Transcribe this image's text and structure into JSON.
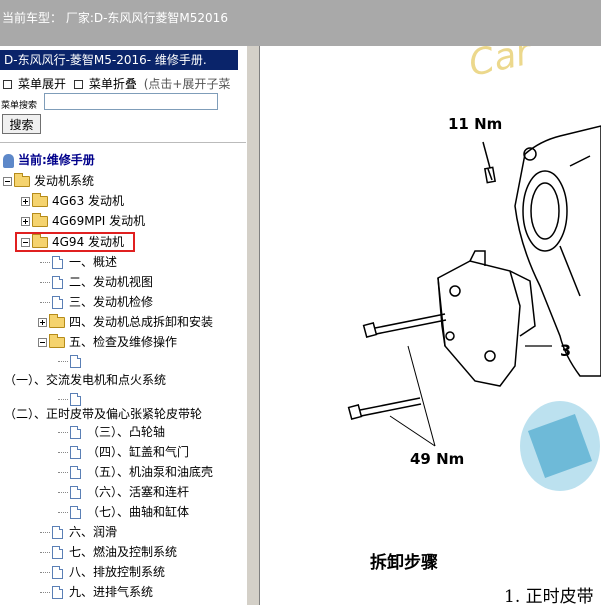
{
  "topbar": {
    "info": "当前车型：  厂家:D-东风风行菱智M52016"
  },
  "sidebar": {
    "title": "D-东风风行-菱智M5-2016- 维修手册.",
    "menu_expand": "菜单展开",
    "menu_collapse": "菜单折叠",
    "menu_hint": "(点击+展开子菜",
    "search_label": "菜单搜索",
    "search_value": "",
    "search_button": "搜索",
    "current_label": "当前:维修手册",
    "tree": [
      {
        "label": "发动机系统"
      },
      {
        "label": "4G63 发动机"
      },
      {
        "label": "4G69MPI 发动机"
      },
      {
        "label": "4G94 发动机"
      },
      {
        "label": "一、概述"
      },
      {
        "label": "二、发动机视图"
      },
      {
        "label": "三、发动机检修"
      },
      {
        "label": "四、发动机总成拆卸和安装"
      },
      {
        "label": "五、检查及维修操作"
      },
      {
        "label": ""
      },
      {
        "label": "（一）、交流发电机和点火系统"
      },
      {
        "label": ""
      },
      {
        "label": "（二）、正时皮带及偏心张紧轮皮带轮"
      },
      {
        "label": "（三）、凸轮轴"
      },
      {
        "label": "（四）、缸盖和气门"
      },
      {
        "label": "（五）、机油泵和油底壳"
      },
      {
        "label": "（六）、活塞和连杆"
      },
      {
        "label": "（七）、曲轴和缸体"
      },
      {
        "label": "六、润滑"
      },
      {
        "label": "七、燃油及控制系统"
      },
      {
        "label": "八、排放控制系统"
      },
      {
        "label": "九、进排气系统"
      }
    ]
  },
  "diagram": {
    "torque_top": "11 Nm",
    "part_number": "3",
    "torque_bottom": "49 Nm",
    "section_title": "拆卸步骤",
    "step_1": "1.  正时皮带",
    "watermark": "Car"
  }
}
